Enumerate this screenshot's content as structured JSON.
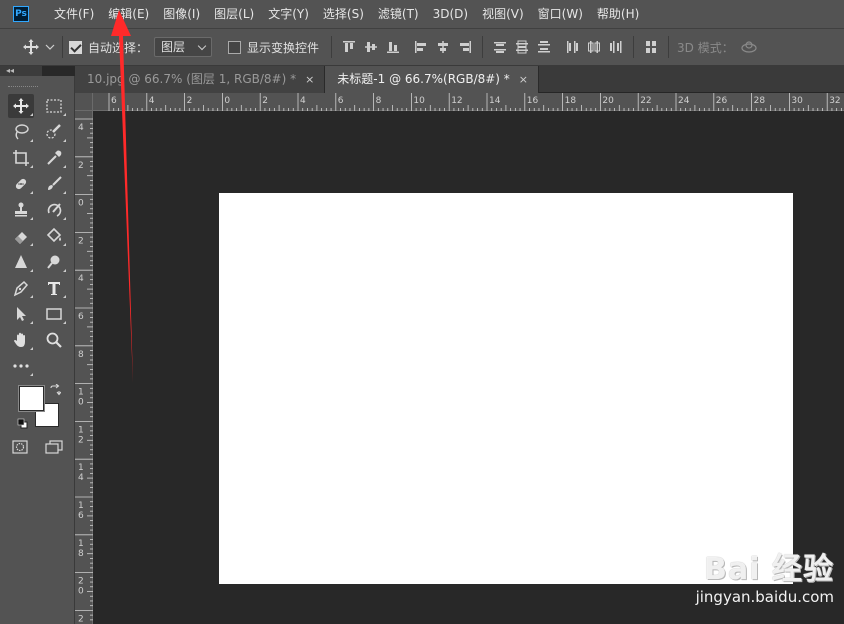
{
  "app": {
    "logo_text": "Ps"
  },
  "menu": [
    {
      "label": "文件(F)"
    },
    {
      "label": "编辑(E)"
    },
    {
      "label": "图像(I)"
    },
    {
      "label": "图层(L)"
    },
    {
      "label": "文字(Y)"
    },
    {
      "label": "选择(S)"
    },
    {
      "label": "滤镜(T)"
    },
    {
      "label": "3D(D)"
    },
    {
      "label": "视图(V)"
    },
    {
      "label": "窗口(W)"
    },
    {
      "label": "帮助(H)"
    }
  ],
  "options": {
    "auto_select_label": "自动选择：",
    "auto_select_checked": true,
    "layer_select_value": "图层",
    "show_transform_label": "显示变换控件",
    "show_transform_checked": false,
    "mode_3d_label": "3D 模式："
  },
  "toolbar": {
    "collapse_glyph": "◂◂"
  },
  "tabs": [
    {
      "label": "10.jpg @ 66.7% (图层 1, RGB/8#) *",
      "close": "×",
      "active": false
    },
    {
      "label": "未标题-1 @ 66.7%(RGB/8#) *",
      "close": "×",
      "active": true
    }
  ],
  "ruler_top_labels": [
    "6",
    "4",
    "2",
    "0",
    "2",
    "4",
    "6",
    "8",
    "10",
    "12",
    "14",
    "16",
    "18",
    "20",
    "22",
    "24",
    "26",
    "28",
    "30",
    "32"
  ],
  "ruler_left_labels": [
    "4",
    "2",
    "0",
    "2",
    "4",
    "6",
    "8",
    "10",
    "12",
    "14",
    "16",
    "18",
    "20",
    "22"
  ],
  "colors": {
    "foreground": "#ffffff",
    "background": "#ffffff",
    "annotation_arrow": "#ff2a2a"
  },
  "watermark": {
    "logo": "Bai 经验",
    "url": "jingyan.baidu.com"
  }
}
